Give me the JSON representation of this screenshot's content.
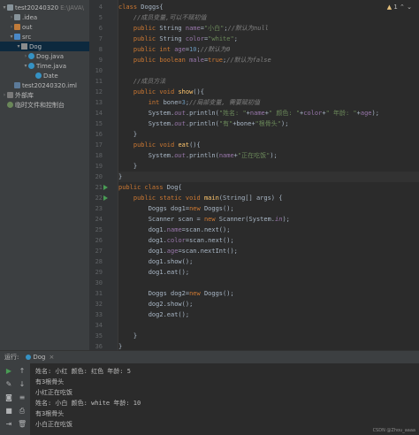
{
  "sidebar": {
    "items": [
      {
        "label": "test20240320",
        "path": "E:\\JAVA\\",
        "icon": "module-folder-icon",
        "indent": 0,
        "chevron": "▾"
      },
      {
        "label": ".idea",
        "icon": "folder-icon",
        "indent": 1,
        "chevron": "›"
      },
      {
        "label": "out",
        "icon": "excluded-folder-icon",
        "indent": 1,
        "chevron": "›"
      },
      {
        "label": "src",
        "icon": "source-folder-icon",
        "indent": 1,
        "chevron": "▾"
      },
      {
        "label": "Dog",
        "icon": "package-icon",
        "indent": 2,
        "chevron": "▾",
        "selected": true
      },
      {
        "label": "Dog.java",
        "icon": "java-class-icon",
        "indent": 3,
        "chevron": "›"
      },
      {
        "label": "Time.java",
        "icon": "java-class-icon",
        "indent": 3,
        "chevron": "▾"
      },
      {
        "label": "Date",
        "icon": "java-class-icon",
        "indent": 4,
        "chevron": ""
      },
      {
        "label": "test20240320.iml",
        "icon": "module-file-icon",
        "indent": 1,
        "chevron": ""
      },
      {
        "label": "外部库",
        "icon": "library-icon",
        "indent": 0,
        "chevron": "›"
      },
      {
        "label": "临时文件和控制台",
        "icon": "scratch-icon",
        "indent": 0,
        "chevron": ""
      }
    ]
  },
  "editor": {
    "warnings": "1",
    "first_line_number": 4,
    "current_line": 20,
    "run_markers": [
      21,
      22
    ],
    "lines": [
      [
        [
          "kw",
          "class "
        ],
        [
          "",
          "Doggs{"
        ]
      ],
      [
        [
          "cmt",
          "    //成员变量,可以不赋初值"
        ]
      ],
      [
        [
          "kw",
          "    public "
        ],
        [
          "",
          "String "
        ],
        [
          "fld",
          "name"
        ],
        [
          "",
          "="
        ],
        [
          "str",
          "\"小白\""
        ],
        [
          "",
          ";"
        ],
        [
          "cmt",
          "//默认为null"
        ]
      ],
      [
        [
          "kw",
          "    public "
        ],
        [
          "",
          "String "
        ],
        [
          "fld",
          "color"
        ],
        [
          "",
          "="
        ],
        [
          "str",
          "\"white\""
        ],
        [
          "",
          ";"
        ]
      ],
      [
        [
          "kw",
          "    public int "
        ],
        [
          "fld",
          "age"
        ],
        [
          "",
          "="
        ],
        [
          "num",
          "10"
        ],
        [
          "",
          ";"
        ],
        [
          "cmt",
          "//默认为0"
        ]
      ],
      [
        [
          "kw",
          "    public boolean "
        ],
        [
          "fld",
          "male"
        ],
        [
          "",
          "="
        ],
        [
          "kw",
          "true"
        ],
        [
          "",
          ";"
        ],
        [
          "cmt",
          "//默认为false"
        ]
      ],
      [
        [
          "",
          ""
        ]
      ],
      [
        [
          "cmt",
          "    //成员方法"
        ]
      ],
      [
        [
          "kw",
          "    public void "
        ],
        [
          "fn",
          "show"
        ],
        [
          "",
          "(){"
        ]
      ],
      [
        [
          "kw",
          "        int "
        ],
        [
          "",
          "bone="
        ],
        [
          "num",
          "3"
        ],
        [
          "",
          ";"
        ],
        [
          "cmt",
          "//局部变量, 需要赋初值"
        ]
      ],
      [
        [
          "",
          "        System."
        ],
        [
          "fldi",
          "out"
        ],
        [
          "",
          ".println("
        ],
        [
          "str",
          "\"姓名: \""
        ],
        [
          "",
          "+"
        ],
        [
          "fld",
          "name"
        ],
        [
          "",
          "+"
        ],
        [
          "str",
          "\" 颜色: \""
        ],
        [
          "",
          "+"
        ],
        [
          "fld",
          "color"
        ],
        [
          "",
          "+"
        ],
        [
          "str",
          "\" 年龄: \""
        ],
        [
          "",
          "+"
        ],
        [
          "fld",
          "age"
        ],
        [
          "",
          ");"
        ]
      ],
      [
        [
          "",
          "        System."
        ],
        [
          "fldi",
          "out"
        ],
        [
          "",
          ".println("
        ],
        [
          "str",
          "\"有\""
        ],
        [
          "",
          "+bone+"
        ],
        [
          "str",
          "\"根骨头\""
        ],
        [
          "",
          ");"
        ]
      ],
      [
        [
          "",
          "    }"
        ]
      ],
      [
        [
          "kw",
          "    public void "
        ],
        [
          "fn",
          "eat"
        ],
        [
          "",
          "(){"
        ]
      ],
      [
        [
          "",
          "        System."
        ],
        [
          "fldi",
          "out"
        ],
        [
          "",
          ".println("
        ],
        [
          "fld",
          "name"
        ],
        [
          "",
          "+"
        ],
        [
          "str",
          "\"正在吃饭\""
        ],
        [
          "",
          ");"
        ]
      ],
      [
        [
          "",
          "    }"
        ]
      ],
      [
        [
          "",
          "}"
        ]
      ],
      [
        [
          "kw",
          "public class "
        ],
        [
          "",
          "Dog{"
        ]
      ],
      [
        [
          "kw",
          "    public static void "
        ],
        [
          "fn",
          "main"
        ],
        [
          "",
          "(String[] args) {"
        ]
      ],
      [
        [
          "",
          "        Doggs dog1="
        ],
        [
          "kw",
          "new "
        ],
        [
          "",
          "Doggs();"
        ]
      ],
      [
        [
          "",
          "        Scanner scan = "
        ],
        [
          "kw",
          "new "
        ],
        [
          "",
          "Scanner(System."
        ],
        [
          "fldi",
          "in"
        ],
        [
          "",
          ");"
        ]
      ],
      [
        [
          "",
          "        dog1."
        ],
        [
          "fld",
          "name"
        ],
        [
          "",
          "=scan.next();"
        ]
      ],
      [
        [
          "",
          "        dog1."
        ],
        [
          "fld",
          "color"
        ],
        [
          "",
          "=scan.next();"
        ]
      ],
      [
        [
          "",
          "        dog1."
        ],
        [
          "fld",
          "age"
        ],
        [
          "",
          "=scan.nextInt();"
        ]
      ],
      [
        [
          "",
          "        dog1.show();"
        ]
      ],
      [
        [
          "",
          "        dog1.eat();"
        ]
      ],
      [
        [
          "",
          ""
        ]
      ],
      [
        [
          "",
          "        Doggs dog2="
        ],
        [
          "kw",
          "new "
        ],
        [
          "",
          "Doggs();"
        ]
      ],
      [
        [
          "",
          "        dog2.show();"
        ]
      ],
      [
        [
          "",
          "        dog2.eat();"
        ]
      ],
      [
        [
          "",
          ""
        ]
      ],
      [
        [
          "",
          "    }"
        ]
      ],
      [
        [
          "",
          "}"
        ]
      ]
    ]
  },
  "run": {
    "title": "运行:",
    "tab_label": "Dog",
    "close_glyph": "×",
    "output": [
      "姓名: 小红 颜色: 红色 年龄: 5",
      "有3根骨头",
      "小红正在吃饭",
      "姓名: 小白 颜色: white 年龄: 10",
      "有3根骨头",
      "小白正在吃饭"
    ],
    "watermark": "CSDN @Zhou_aaaa"
  }
}
